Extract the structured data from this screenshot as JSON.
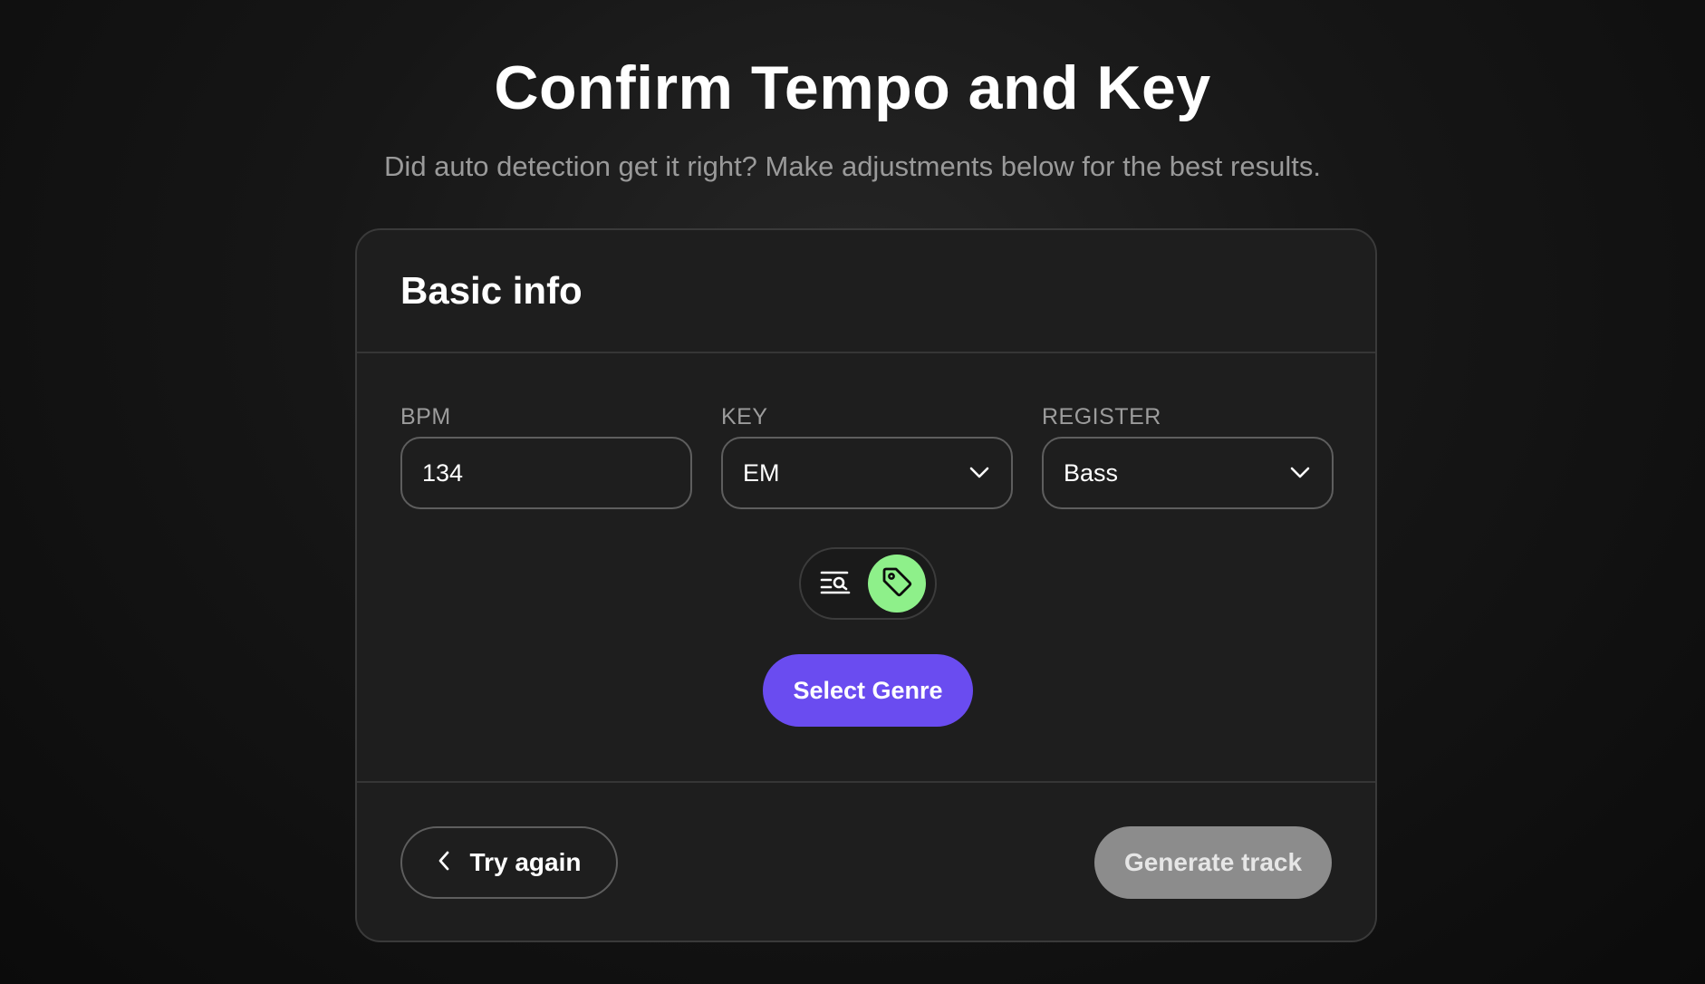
{
  "header": {
    "title": "Confirm Tempo and Key",
    "subtitle": "Did auto detection get it right? Make adjustments below for the best results."
  },
  "card": {
    "title": "Basic info",
    "fields": {
      "bpm": {
        "label": "BPM",
        "value": "134"
      },
      "key": {
        "label": "KEY",
        "value": "EM"
      },
      "register": {
        "label": "REGISTER",
        "value": "Bass"
      }
    },
    "view_toggle": {
      "options": [
        {
          "icon": "list-search-icon",
          "active": false
        },
        {
          "icon": "tag-icon",
          "active": true
        }
      ],
      "active_color": "#8ef08a"
    },
    "genre_button_label": "Select Genre",
    "genre_button_color": "#6a4cf0"
  },
  "footer": {
    "back_label": "Try again",
    "generate_label": "Generate track",
    "generate_color": "#8c8c8c"
  }
}
